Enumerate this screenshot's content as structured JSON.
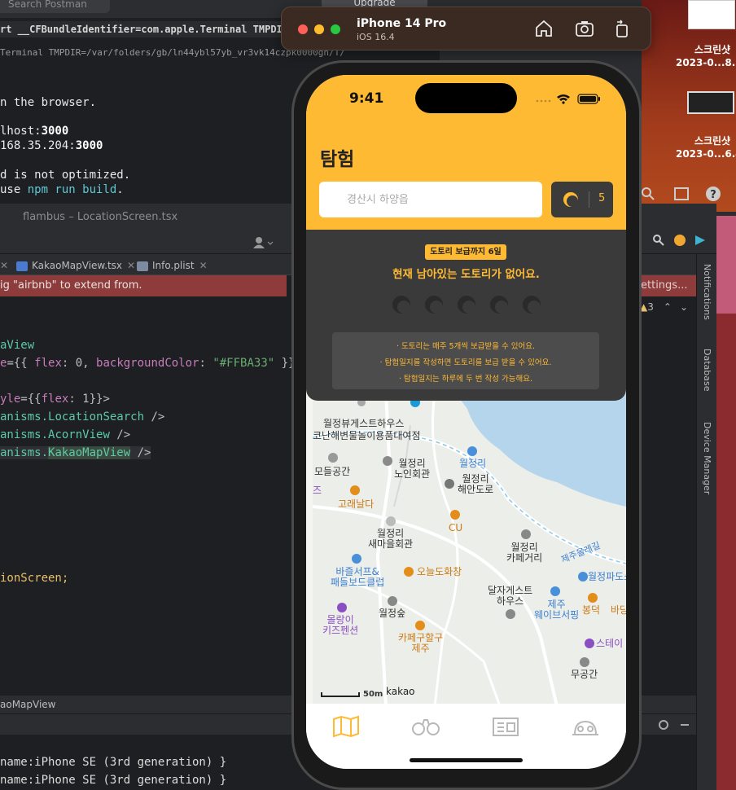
{
  "terminal": {
    "search_placeholder": "Search Postman",
    "upgrade_label": "Upgrade",
    "cmd_line": "rt __CFBundleIdentifier=com.apple.Terminal TMPDIR=/",
    "cmd_line2": "Terminal TMPDIR=/var/folders/gb/ln44ybl57yb_vr3vk14czpk0000gn/T/",
    "lines": {
      "browser": "n the browser.",
      "local_prefix": "lhost:",
      "local_port": "3000",
      "network_prefix": "168.35.204:",
      "network_port": "3000",
      "not_optimized": "d is not optimized.",
      "use_prefix": "use ",
      "use_cmd": "npm run build",
      "use_suffix": "."
    }
  },
  "ide": {
    "window_title": "flambus – LocationScreen.tsx",
    "tabs": [
      "KakaoMapView.tsx",
      "Info.plist"
    ],
    "error_banner": "ig \"airbnb\" to extend from.",
    "error_link": "ettings...",
    "inspection_count": "3",
    "code": {
      "l1": "aView",
      "l2_prop": "e",
      "l2_rest": "={{ ",
      "l2_flex": "flex",
      "l2_mid": ": 0, ",
      "l2_bg": "backgroundColor",
      "l2_colon": ": ",
      "l2_color": "\"#FFBA33\"",
      "l2_end": " }}",
      "l3_a": "yle",
      "l3_b": "={{",
      "l3_flex": "flex",
      "l3_c": ": 1}}>",
      "l4_a": "anisms.",
      "l4_b": "LocationSearch",
      "l4_c": " />",
      "l5_a": "anisms.",
      "l5_b": "AcornView",
      "l5_c": " />",
      "l6_a": "anisms.",
      "l6_b": "KakaoMapView",
      "l6_c": " />",
      "l7": "ionScreen;"
    },
    "breadcrumb": "aoMapView",
    "run_output": [
      "name:iPhone SE (3rd generation) }",
      "name:iPhone SE (3rd generation) }"
    ],
    "side_tools": [
      "Notifications",
      "Database",
      "Device Manager"
    ]
  },
  "desktop": {
    "files": [
      {
        "name": "스크린샷",
        "date": "2023-0...8.32"
      },
      {
        "name": "스크린샷",
        "date": "2023-0...6.42"
      }
    ]
  },
  "simulator": {
    "device": "iPhone 14 Pro",
    "os": "iOS 16.4",
    "buttons": [
      "home-icon",
      "screenshot-icon",
      "rotate-icon"
    ]
  },
  "app": {
    "time": "9:41",
    "title": "탐험",
    "search_placeholder": "경산시 하양읍",
    "acorn_count": "5",
    "badge": "도토리 보급까지 6일",
    "notice": "현재 남아있는 도토리가 없어요.",
    "acorn_slots": 5,
    "info_lines": [
      "· 도토리는 매주 5개씩 보급받을 수 있어요.",
      "· 탐험일지를 작성하면 도토리를 보급 받을 수 있어요.",
      "· 탐험일지는 하루에 두 번 작성 가능해요."
    ],
    "map": {
      "labels": [
        {
          "id": "guesthouse",
          "text": "월정뷰게스트하우스"
        },
        {
          "id": "rental",
          "text": "코난해변물놀이용품대여점"
        },
        {
          "id": "space",
          "text": "모들공간"
        },
        {
          "id": "elder",
          "text": "월정리\n노인회관"
        },
        {
          "id": "coast",
          "text": "월정리\n해안도로"
        },
        {
          "id": "wj",
          "text": "월정리"
        },
        {
          "id": "whale",
          "text": "고래날다"
        },
        {
          "id": "cu",
          "text": "CU"
        },
        {
          "id": "village",
          "text": "월정리\n새마을회관"
        },
        {
          "id": "cafe_st",
          "text": "월정리\n카페거리"
        },
        {
          "id": "surf",
          "text": "바즐서프&\n패들보드클럽"
        },
        {
          "id": "onl",
          "text": "오늘도화창"
        },
        {
          "id": "dalja",
          "text": "달자게스트\n하우스"
        },
        {
          "id": "wjsup",
          "text": "제주\n웨이브서핑"
        },
        {
          "id": "wjsoop",
          "text": "월정숲"
        },
        {
          "id": "mollangi",
          "text": "몰랑이\n키즈펜션"
        },
        {
          "id": "bongdeok",
          "text": "봉덕"
        },
        {
          "id": "bat",
          "text": "바당"
        },
        {
          "id": "cafehg",
          "text": "카페구할구\n제주"
        },
        {
          "id": "stay",
          "text": "스테이"
        },
        {
          "id": "mugong",
          "text": "무공간"
        },
        {
          "id": "wjpd",
          "text": "월정파도쇼"
        },
        {
          "id": "road",
          "text": "제주올레길"
        },
        {
          "id": "z",
          "text": "즈"
        }
      ],
      "scale": "50m",
      "logo": "kakao"
    },
    "tabs": [
      "map-tab",
      "explore-tab",
      "journal-tab",
      "community-tab"
    ]
  }
}
